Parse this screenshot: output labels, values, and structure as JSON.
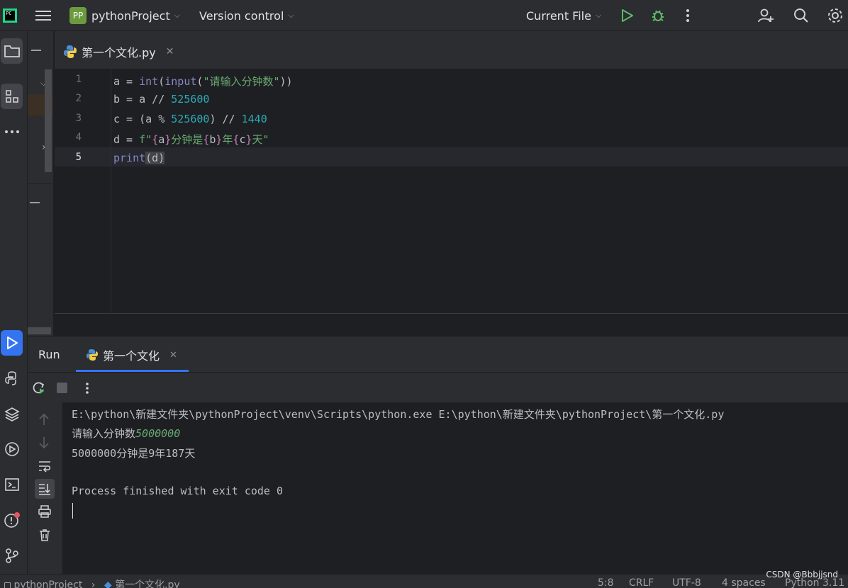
{
  "titlebar": {
    "logo_text": "PC",
    "project_badge": "PP",
    "project_name": "pythonProject",
    "vcs_label": "Version control",
    "run_config": "Current File"
  },
  "editor": {
    "tab_label": "第一个文化.py",
    "lines": [
      {
        "n": "1"
      },
      {
        "n": "2"
      },
      {
        "n": "3"
      },
      {
        "n": "4"
      },
      {
        "n": "5"
      }
    ],
    "code": {
      "l1_a": "a = ",
      "l1_int": "int",
      "l1_p1": "(",
      "l1_input": "input",
      "l1_p2": "(",
      "l1_str": "\"请输入分钟数\"",
      "l1_p3": "))",
      "l2_a": "b = a // ",
      "l2_n": "525600",
      "l3_a": "c = (a % ",
      "l3_n1": "525600",
      "l3_b": ") // ",
      "l3_n2": "1440",
      "l4_a": "d = ",
      "l4_f": "f\"",
      "l4_b1": "{",
      "l4_v1": "a",
      "l4_b2": "}",
      "l4_s1": "分钟是",
      "l4_b3": "{",
      "l4_v2": "b",
      "l4_b4": "}",
      "l4_s2": "年",
      "l4_b5": "{",
      "l4_v3": "c",
      "l4_b6": "}",
      "l4_s3": "天\"",
      "l5_print": "print",
      "l5_rest": "(d)"
    }
  },
  "run": {
    "title": "Run",
    "tab_label": "第一个文化",
    "console": {
      "cmd": "E:\\python\\新建文件夹\\pythonProject\\venv\\Scripts\\python.exe E:\\python\\新建文件夹\\pythonProject\\第一个文化.py",
      "prompt": "请输入分钟数",
      "input_value": "5000000",
      "output": "5000000分钟是9年187天",
      "exit": "Process finished with exit code 0"
    }
  },
  "statusbar": {
    "breadcrumb_project": "pythonProject",
    "breadcrumb_file": "第一个文化.py",
    "position": "5:8",
    "line_sep": "CRLF",
    "encoding": "UTF-8",
    "indent": "4 spaces",
    "interpreter": "Python 3.11"
  },
  "watermark": "CSDN @Bbbjjsnd",
  "colors": {
    "accent": "#3574f0",
    "run_green": "#5fb865",
    "background": "#1e1f22",
    "panel": "#2b2d30"
  }
}
